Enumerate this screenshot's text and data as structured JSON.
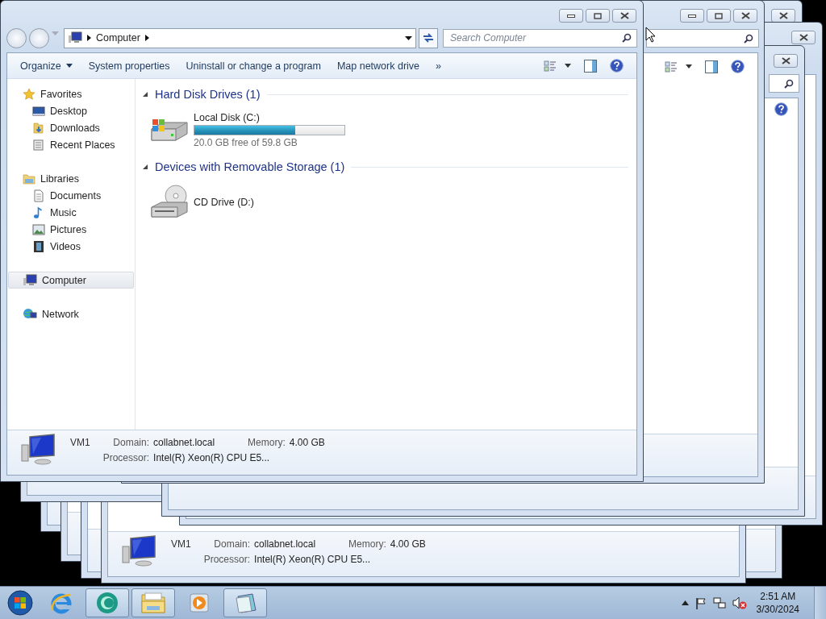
{
  "window": {
    "address": [
      "Computer"
    ],
    "search": {
      "placeholder": "Search Computer"
    },
    "commands": [
      {
        "label": "Organize",
        "kind": "menu"
      },
      {
        "label": "System properties",
        "kind": "plain"
      },
      {
        "label": "Uninstall or change a program",
        "kind": "plain"
      },
      {
        "label": "Map network drive",
        "kind": "plain"
      }
    ],
    "more": "»"
  },
  "navigation": [
    {
      "label": "Favorites",
      "kind": "favorites",
      "selected": false,
      "children": [
        {
          "label": "Desktop",
          "kind": "desktop",
          "selected": false
        },
        {
          "label": "Downloads",
          "kind": "downloads",
          "selected": false
        },
        {
          "label": "Recent Places",
          "kind": "recent",
          "selected": false
        }
      ]
    },
    {
      "label": "Libraries",
      "kind": "libraries",
      "selected": false,
      "children": [
        {
          "label": "Documents",
          "kind": "documents",
          "selected": false
        },
        {
          "label": "Music",
          "kind": "music",
          "selected": false
        },
        {
          "label": "Pictures",
          "kind": "pictures",
          "selected": false
        },
        {
          "label": "Videos",
          "kind": "videos",
          "selected": false
        }
      ]
    },
    {
      "label": "Computer",
      "kind": "computer",
      "selected": true
    },
    {
      "label": "Network",
      "kind": "network",
      "selected": false
    }
  ],
  "groups": [
    {
      "title": "Hard Disk Drives (1)",
      "expanded": true,
      "items": [
        {
          "name": "Local Disk (C:)",
          "kind": "hdd",
          "level": 0.67,
          "free": "20.0 GB free of 59.8 GB"
        }
      ]
    },
    {
      "title": "Devices with Removable Storage (1)",
      "expanded": true,
      "items": [
        {
          "name": "CD Drive (D:)",
          "kind": "cd"
        }
      ]
    }
  ],
  "details": {
    "name": "VM1",
    "domain_label": "Domain:",
    "domain": "collabnet.local",
    "memory_label": "Memory:",
    "memory": "4.00 GB",
    "processor_label": "Processor:",
    "processor": "Intel(R) Xeon(R) CPU E5..."
  },
  "background_window": {
    "details": {
      "name": "VM1",
      "domain_label": "Domain:",
      "domain": "collabnet.local",
      "memory_label": "Memory:",
      "memory": "4.00 GB",
      "processor_label": "Processor:",
      "processor": "Intel(R) Xeon(R) CPU E5..."
    }
  },
  "taskbar": {
    "apps": [
      {
        "kind": "ie",
        "active": false
      },
      {
        "kind": "orb",
        "active": true
      },
      {
        "kind": "explorer",
        "active": true
      },
      {
        "kind": "media",
        "active": false
      },
      {
        "kind": "notepad",
        "active": true
      }
    ],
    "clock": {
      "time": "2:51 AM",
      "date": "3/30/2024"
    }
  }
}
